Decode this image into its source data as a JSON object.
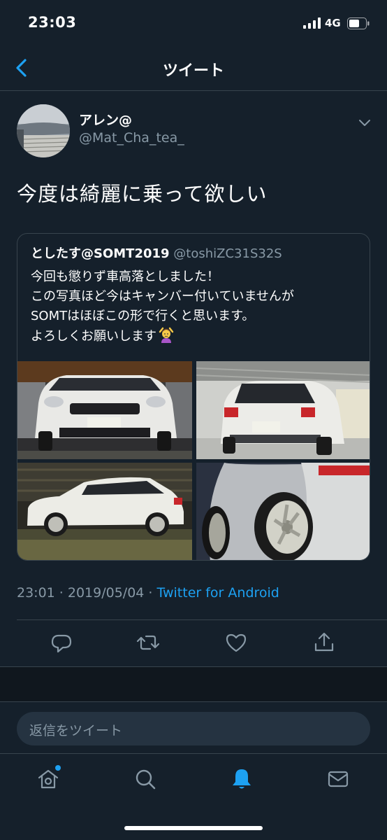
{
  "status_bar": {
    "time": "23:03",
    "network": "4G"
  },
  "nav": {
    "title": "ツイート"
  },
  "tweet": {
    "author_name": "アレン@",
    "author_handle": "@Mat_Cha_tea_",
    "text": "今度は綺麗に乗って欲しい",
    "timestamp": "23:01 · 2019/05/04 · ",
    "source": "Twitter for Android"
  },
  "quoted_tweet": {
    "author_name": "としたす@SOMT2019",
    "author_handle": "@toshiZC31S32S",
    "lines": [
      "今回も懲りず車高落としました！",
      "この写真ほど今はキャンバー付いていませんが",
      "SOMTはほぼこの形で行くと思います。",
      "よろしくお願いします"
    ],
    "emoji": "person-gesturing-ok-icon"
  },
  "reply": {
    "placeholder": "返信をツイート"
  },
  "colors": {
    "background": "#15202b",
    "accent": "#1da1f2",
    "secondary_text": "#8899a6",
    "border": "#38444d"
  }
}
